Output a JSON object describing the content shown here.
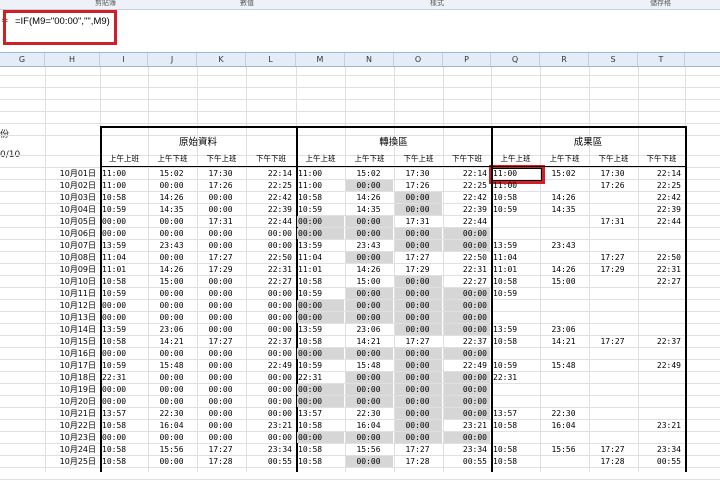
{
  "ribbon": {
    "groups": [
      "剪貼簿",
      "數值",
      "樣式",
      "儲存格"
    ]
  },
  "formula_bar": {
    "mark": "=",
    "formula": "=IF(M9=\"00:00\",\"\",M9)"
  },
  "columns": [
    "G",
    "H",
    "I",
    "J",
    "K",
    "L",
    "M",
    "N",
    "O",
    "P",
    "Q",
    "R",
    "S",
    "T"
  ],
  "left_fragments": [
    "份",
    "0/10"
  ],
  "groups": [
    {
      "title": "原始資料"
    },
    {
      "title": "轉換區"
    },
    {
      "title": "成果區"
    }
  ],
  "subheaders": [
    "上午上班",
    "上午下班",
    "下午上班",
    "下午下班"
  ],
  "dates": [
    "10月01日",
    "10月02日",
    "10月03日",
    "10月04日",
    "10月05日",
    "10月06日",
    "10月07日",
    "10月08日",
    "10月09日",
    "10月10日",
    "10月11日",
    "10月12日",
    "10月13日",
    "10月14日",
    "10月15日",
    "10月16日",
    "10月17日",
    "10月18日",
    "10月19日",
    "10月20日",
    "10月21日",
    "10月22日",
    "10月23日",
    "10月24日",
    "10月25日"
  ],
  "original": [
    [
      "11:00",
      "15:02",
      "17:30",
      "22:14"
    ],
    [
      "11:00",
      "00:00",
      "17:26",
      "22:25"
    ],
    [
      "10:58",
      "14:26",
      "00:00",
      "22:42"
    ],
    [
      "10:59",
      "14:35",
      "00:00",
      "22:39"
    ],
    [
      "00:00",
      "00:00",
      "17:31",
      "22:44"
    ],
    [
      "00:00",
      "00:00",
      "00:00",
      "00:00"
    ],
    [
      "13:59",
      "23:43",
      "00:00",
      "00:00"
    ],
    [
      "11:04",
      "00:00",
      "17:27",
      "22:50"
    ],
    [
      "11:01",
      "14:26",
      "17:29",
      "22:31"
    ],
    [
      "10:58",
      "15:00",
      "00:00",
      "22:27"
    ],
    [
      "10:59",
      "00:00",
      "00:00",
      "00:00"
    ],
    [
      "00:00",
      "00:00",
      "00:00",
      "00:00"
    ],
    [
      "00:00",
      "00:00",
      "00:00",
      "00:00"
    ],
    [
      "13:59",
      "23:06",
      "00:00",
      "00:00"
    ],
    [
      "10:58",
      "14:21",
      "17:27",
      "22:37"
    ],
    [
      "00:00",
      "00:00",
      "00:00",
      "00:00"
    ],
    [
      "10:59",
      "15:48",
      "00:00",
      "22:49"
    ],
    [
      "22:31",
      "00:00",
      "00:00",
      "00:00"
    ],
    [
      "00:00",
      "00:00",
      "00:00",
      "00:00"
    ],
    [
      "00:00",
      "00:00",
      "00:00",
      "00:00"
    ],
    [
      "13:57",
      "22:30",
      "00:00",
      "00:00"
    ],
    [
      "10:58",
      "16:04",
      "00:00",
      "23:21"
    ],
    [
      "00:00",
      "00:00",
      "00:00",
      "00:00"
    ],
    [
      "10:58",
      "15:56",
      "17:27",
      "23:34"
    ],
    [
      "10:58",
      "00:00",
      "17:28",
      "00:55"
    ]
  ],
  "converted": [
    [
      "11:00",
      "15:02",
      "17:30",
      "22:14"
    ],
    [
      "11:00",
      "00:00",
      "17:26",
      "22:25"
    ],
    [
      "10:58",
      "14:26",
      "00:00",
      "22:42"
    ],
    [
      "10:59",
      "14:35",
      "00:00",
      "22:39"
    ],
    [
      "00:00",
      "00:00",
      "17:31",
      "22:44"
    ],
    [
      "00:00",
      "00:00",
      "00:00",
      "00:00"
    ],
    [
      "13:59",
      "23:43",
      "00:00",
      "00:00"
    ],
    [
      "11:04",
      "00:00",
      "17:27",
      "22:50"
    ],
    [
      "11:01",
      "14:26",
      "17:29",
      "22:31"
    ],
    [
      "10:58",
      "15:00",
      "00:00",
      "22:27"
    ],
    [
      "10:59",
      "00:00",
      "00:00",
      "00:00"
    ],
    [
      "00:00",
      "00:00",
      "00:00",
      "00:00"
    ],
    [
      "00:00",
      "00:00",
      "00:00",
      "00:00"
    ],
    [
      "13:59",
      "23:06",
      "00:00",
      "00:00"
    ],
    [
      "10:58",
      "14:21",
      "17:27",
      "22:37"
    ],
    [
      "00:00",
      "00:00",
      "00:00",
      "00:00"
    ],
    [
      "10:59",
      "15:48",
      "00:00",
      "22:49"
    ],
    [
      "22:31",
      "00:00",
      "00:00",
      "00:00"
    ],
    [
      "00:00",
      "00:00",
      "00:00",
      "00:00"
    ],
    [
      "00:00",
      "00:00",
      "00:00",
      "00:00"
    ],
    [
      "13:57",
      "22:30",
      "00:00",
      "00:00"
    ],
    [
      "10:58",
      "16:04",
      "00:00",
      "23:21"
    ],
    [
      "00:00",
      "00:00",
      "00:00",
      "00:00"
    ],
    [
      "10:58",
      "15:56",
      "17:27",
      "23:34"
    ],
    [
      "10:58",
      "00:00",
      "17:28",
      "00:55"
    ]
  ],
  "result": [
    [
      "11:00",
      "15:02",
      "17:30",
      "22:14"
    ],
    [
      "11:00",
      "",
      "17:26",
      "22:25"
    ],
    [
      "10:58",
      "14:26",
      "",
      "22:42"
    ],
    [
      "10:59",
      "14:35",
      "",
      "22:39"
    ],
    [
      "",
      "",
      "17:31",
      "22:44"
    ],
    [
      "",
      "",
      "",
      ""
    ],
    [
      "13:59",
      "23:43",
      "",
      ""
    ],
    [
      "11:04",
      "",
      "17:27",
      "22:50"
    ],
    [
      "11:01",
      "14:26",
      "17:29",
      "22:31"
    ],
    [
      "10:58",
      "15:00",
      "",
      "22:27"
    ],
    [
      "10:59",
      "",
      "",
      ""
    ],
    [
      "",
      "",
      "",
      ""
    ],
    [
      "",
      "",
      "",
      ""
    ],
    [
      "13:59",
      "23:06",
      "",
      ""
    ],
    [
      "10:58",
      "14:21",
      "17:27",
      "22:37"
    ],
    [
      "",
      "",
      "",
      ""
    ],
    [
      "10:59",
      "15:48",
      "",
      "22:49"
    ],
    [
      "22:31",
      "",
      "",
      ""
    ],
    [
      "",
      "",
      "",
      ""
    ],
    [
      "",
      "",
      "",
      ""
    ],
    [
      "13:57",
      "22:30",
      "",
      ""
    ],
    [
      "10:58",
      "16:04",
      "",
      "23:21"
    ],
    [
      "",
      "",
      "",
      ""
    ],
    [
      "10:58",
      "15:56",
      "17:27",
      "23:34"
    ],
    [
      "10:58",
      "",
      "17:28",
      "00:55"
    ]
  ],
  "colors": {
    "highlight_red": "#d21f26",
    "shade_gray": "#d6d6d6",
    "header_blue": "#e4ecf7"
  }
}
